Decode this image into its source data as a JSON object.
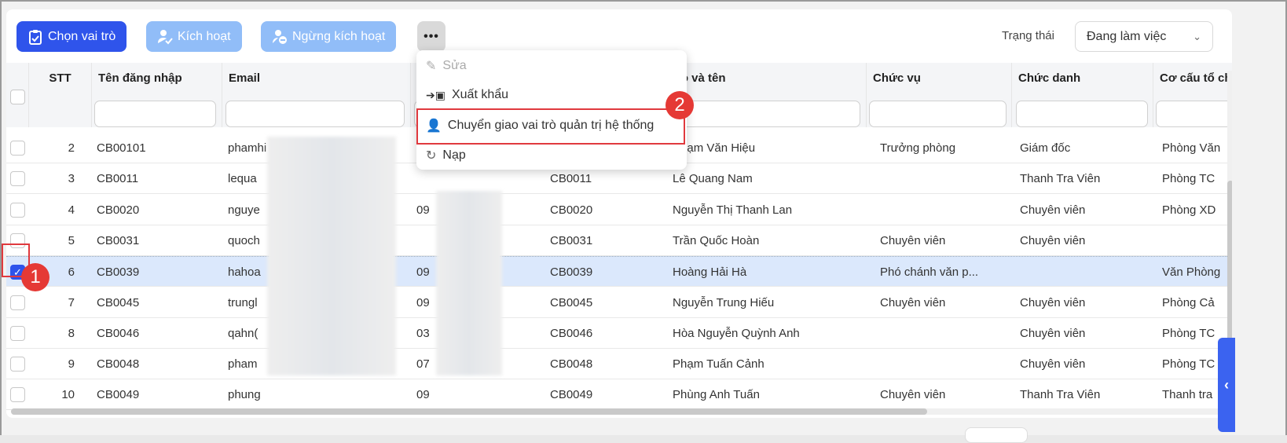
{
  "toolbar": {
    "choose_role": "Chọn vai trò",
    "activate": "Kích hoạt",
    "deactivate": "Ngừng kích hoạt",
    "more": "•••"
  },
  "status_filter": {
    "label": "Trạng thái",
    "value": "Đang làm việc"
  },
  "columns": [
    "STT",
    "Tên đăng nhập",
    "Email",
    "",
    "",
    "Họ và tên",
    "Chức vụ",
    "Chức danh",
    "Cơ cấu tổ chức"
  ],
  "menu": {
    "items": [
      {
        "label": "Sửa",
        "icon": "pencil-icon",
        "disabled": true
      },
      {
        "label": "Xuất khẩu",
        "icon": "export-icon"
      },
      {
        "label": "Chuyển giao vai trò quản trị hệ thống",
        "icon": "user-transfer-icon"
      },
      {
        "label": "Nạp",
        "icon": "refresh-icon"
      }
    ]
  },
  "annotations": {
    "step1": "1",
    "step2": "2"
  },
  "rows": [
    {
      "stt": "2",
      "username": "CB00101",
      "email": "phamhi",
      "phone": "",
      "code": "",
      "name": "Phạm Văn Hiệu",
      "position": "Trưởng phòng",
      "title": "Giám đốc",
      "org": "Phòng Văn",
      "checked": false
    },
    {
      "stt": "3",
      "username": "CB0011",
      "email": "lequa",
      "phone": "",
      "code": "CB0011",
      "name": "Lê Quang Nam",
      "position": "",
      "title": "Thanh Tra Viên",
      "org": "Phòng TC",
      "checked": false
    },
    {
      "stt": "4",
      "username": "CB0020",
      "email": "nguye",
      "phone": "09",
      "code": "CB0020",
      "name": "Nguyễn Thị Thanh Lan",
      "position": "",
      "title": "Chuyên viên",
      "org": "Phòng XD",
      "checked": false
    },
    {
      "stt": "5",
      "username": "CB0031",
      "email": "quoch",
      "phone": "",
      "code": "CB0031",
      "name": "Trần Quốc Hoàn",
      "position": "Chuyên viên",
      "title": "Chuyên viên",
      "org": "",
      "checked": false
    },
    {
      "stt": "6",
      "username": "CB0039",
      "email": "hahoa",
      "phone": "09",
      "code": "CB0039",
      "name": "Hoàng Hải Hà",
      "position": "Phó chánh văn p...",
      "title": "",
      "org": "Văn Phòng",
      "checked": true
    },
    {
      "stt": "7",
      "username": "CB0045",
      "email": "trungl",
      "phone": "09",
      "code": "CB0045",
      "name": "Nguyễn Trung Hiếu",
      "position": "Chuyên viên",
      "title": "Chuyên viên",
      "org": "Phòng Cả",
      "checked": false
    },
    {
      "stt": "8",
      "username": "CB0046",
      "email": "qahn(",
      "phone": "03",
      "code": "CB0046",
      "name": "Hòa Nguyễn Quỳnh Anh",
      "position": "",
      "title": "Chuyên viên",
      "org": "Phòng TC",
      "checked": false
    },
    {
      "stt": "9",
      "username": "CB0048",
      "email": "pham",
      "phone": "07",
      "code": "CB0048",
      "name": "Phạm Tuấn Cảnh",
      "position": "",
      "title": "Chuyên viên",
      "org": "Phòng TC",
      "checked": false
    },
    {
      "stt": "10",
      "username": "CB0049",
      "email": "phung",
      "phone": "09",
      "code": "CB0049",
      "name": "Phùng Anh Tuấn",
      "position": "Chuyên viên",
      "title": "Thanh Tra Viên",
      "org": "Thanh tra",
      "checked": false
    }
  ]
}
